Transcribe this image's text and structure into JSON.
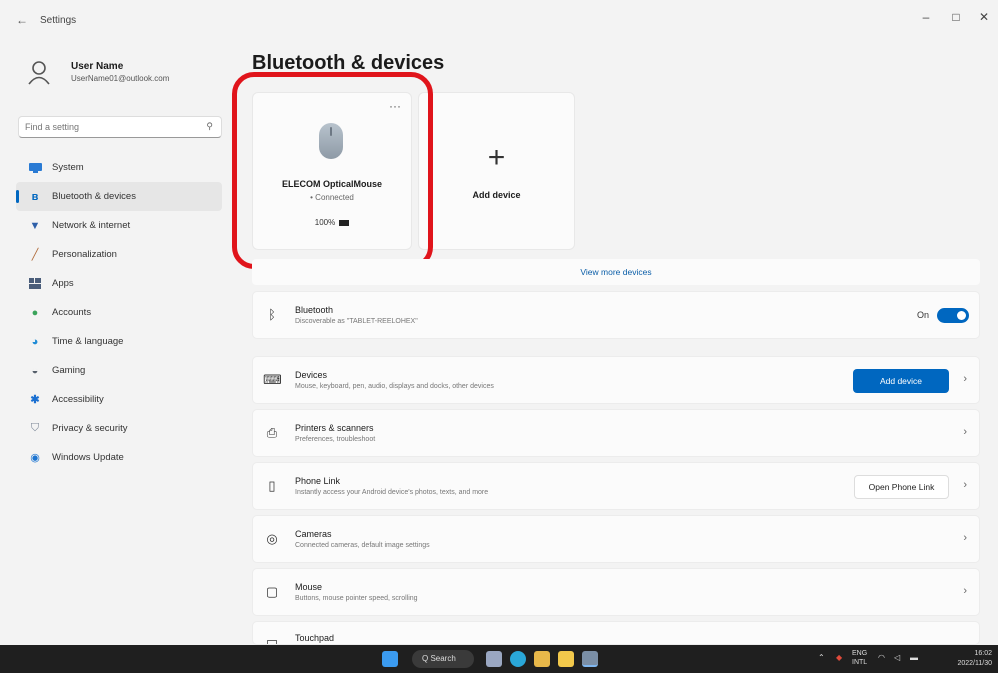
{
  "window": {
    "title": "Settings",
    "back": "←",
    "minimize": "–",
    "maximize": "□",
    "close": "✕"
  },
  "profile": {
    "name": "User Name",
    "email": "UserName01@outlook.com"
  },
  "search": {
    "placeholder": "Find a setting"
  },
  "nav": [
    {
      "label": "System",
      "icon": "monitor-icon",
      "color": "#2a7bd4"
    },
    {
      "label": "Bluetooth & devices",
      "icon": "bluetooth-icon",
      "color": "#0067c0",
      "active": true
    },
    {
      "label": "Network & internet",
      "icon": "wifi-icon",
      "color": "#2d5fa8"
    },
    {
      "label": "Personalization",
      "icon": "brush-icon",
      "color": "#b06b3a"
    },
    {
      "label": "Apps",
      "icon": "apps-icon",
      "color": "#4a5d7a"
    },
    {
      "label": "Accounts",
      "icon": "person-icon",
      "color": "#3aa35a"
    },
    {
      "label": "Time & language",
      "icon": "globe-clock-icon",
      "color": "#1e8bd6"
    },
    {
      "label": "Gaming",
      "icon": "controller-icon",
      "color": "#555e6a"
    },
    {
      "label": "Accessibility",
      "icon": "accessibility-icon",
      "color": "#1a6fd1"
    },
    {
      "label": "Privacy & security",
      "icon": "shield-icon",
      "color": "#7b8696"
    },
    {
      "label": "Windows Update",
      "icon": "update-icon",
      "color": "#1b74d1"
    }
  ],
  "page": {
    "title": "Bluetooth & devices"
  },
  "device_card": {
    "name": "ELECOM OpticalMouse",
    "status": "• Connected",
    "battery": "100%",
    "more": "···"
  },
  "add_card": {
    "plus": "+",
    "label": "Add device"
  },
  "view_more": "View more devices",
  "rows": {
    "bluetooth": {
      "title": "Bluetooth",
      "subtitle": "Discoverable as \"TABLET-REELOHEX\"",
      "toggle_label": "On",
      "toggle_on": true
    },
    "devices": {
      "title": "Devices",
      "subtitle": "Mouse, keyboard, pen, audio, displays and docks, other devices",
      "button": "Add device"
    },
    "printers": {
      "title": "Printers & scanners",
      "subtitle": "Preferences, troubleshoot"
    },
    "phone": {
      "title": "Phone Link",
      "subtitle": "Instantly access your Android device's photos, texts, and more",
      "button": "Open Phone Link"
    },
    "cameras": {
      "title": "Cameras",
      "subtitle": "Connected cameras, default image settings"
    },
    "mouse": {
      "title": "Mouse",
      "subtitle": "Buttons, mouse pointer speed, scrolling"
    },
    "touchpad": {
      "title": "Touchpad"
    }
  },
  "taskbar": {
    "search": "Q Search",
    "lang_top": "ENG",
    "lang_bottom": "INTL",
    "time": "16:02",
    "date": "2022/11/30"
  },
  "colors": {
    "accent": "#0067c0",
    "highlight": "#e0141b",
    "taskbar": "#1f1f1f"
  }
}
